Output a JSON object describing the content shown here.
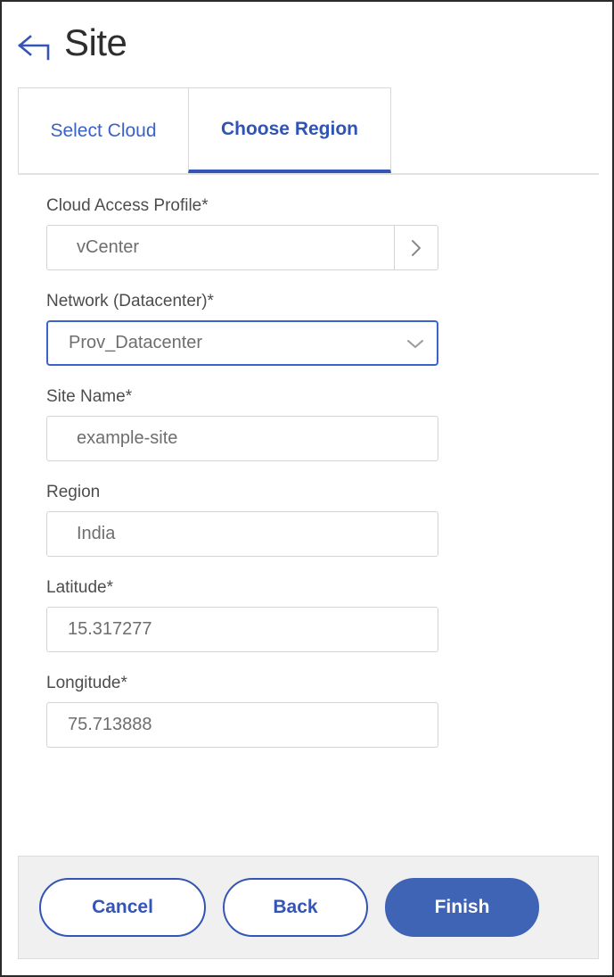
{
  "header": {
    "back_icon": "back-arrow-icon",
    "title": "Site"
  },
  "tabs": [
    {
      "label": "Select Cloud",
      "active": false
    },
    {
      "label": "Choose Region",
      "active": true
    }
  ],
  "form": {
    "fields": [
      {
        "label": "Cloud Access Profile*",
        "value": "vCenter",
        "control": "input-with-button",
        "icon": "chevron-right-icon"
      },
      {
        "label": "Network (Datacenter)*",
        "value": "Prov_Datacenter",
        "control": "dropdown",
        "icon": "chevron-down-icon",
        "focused": true
      },
      {
        "label": "Site Name*",
        "value": "example-site",
        "control": "input"
      },
      {
        "label": "Region",
        "value": "India",
        "control": "input"
      },
      {
        "label": "Latitude*",
        "value": "15.317277",
        "control": "input"
      },
      {
        "label": "Longitude*",
        "value": "75.713888",
        "control": "input"
      }
    ]
  },
  "footer": {
    "cancel_label": "Cancel",
    "back_label": "Back",
    "finish_label": "Finish"
  },
  "colors": {
    "accent_blue": "#3455b5",
    "primary_button": "#3f63b5",
    "tab_link": "#3a62c4",
    "label_text": "#4d4d4d",
    "value_text": "#6e6e6e",
    "footer_bg": "#f0f0f0",
    "border": "#d4d4d4"
  }
}
